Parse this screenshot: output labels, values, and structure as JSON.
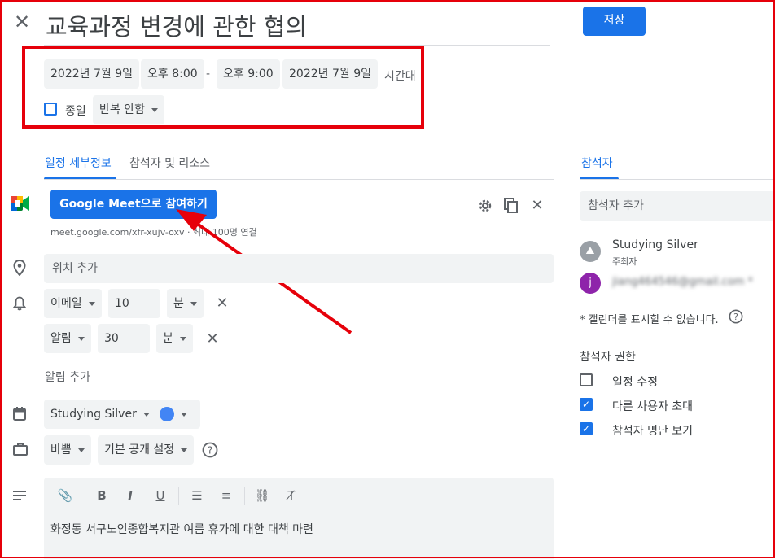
{
  "header": {
    "title": "교육과정 변경에 관한 협의",
    "save_label": "저장"
  },
  "datetime": {
    "start_date": "2022년 7월 9일",
    "start_time": "오후 8:00",
    "separator": "-",
    "end_time": "오후 9:00",
    "end_date": "2022년 7월 9일",
    "timezone_label": "시간대",
    "all_day_label": "종일",
    "repeat_label": "반복 안함"
  },
  "tabs": {
    "details": "일정 세부정보",
    "guests_resources": "참석자 및 리소스",
    "guests": "참석자"
  },
  "meet": {
    "join_label": "Google Meet으로 참여하기",
    "link_text": "meet.google.com/xfr-xujv-oxv · 최대 100명 연결"
  },
  "location": {
    "placeholder": "위치 추가"
  },
  "notifications": [
    {
      "type": "이메일",
      "value": "10",
      "unit": "분"
    },
    {
      "type": "알림",
      "value": "30",
      "unit": "분"
    }
  ],
  "add_notification_label": "알림 추가",
  "calendar": {
    "name": "Studying Silver",
    "color": "#4285f4"
  },
  "visibility": {
    "busy_label": "바쁨",
    "privacy_label": "기본 공개 설정"
  },
  "description": {
    "text": "화정동 서구노인종합복지관 여름 휴가에 대한 대책 마련"
  },
  "guests_panel": {
    "add_placeholder": "참석자 추가",
    "organizer": {
      "name": "Studying Silver",
      "role": "주최자"
    },
    "guest": {
      "initial": "j",
      "email": "jiang464546@gmail.com *"
    },
    "calendar_note": "* 캘린더를 표시할 수 없습니다.",
    "permissions_title": "참석자 권한",
    "permissions": [
      {
        "label": "일정 수정",
        "checked": false
      },
      {
        "label": "다른 사용자 초대",
        "checked": true
      },
      {
        "label": "참석자 명단 보기",
        "checked": true
      }
    ]
  },
  "colors": {
    "accent": "#1a73e8",
    "annotation": "#e6000a",
    "guest_avatar": "#8e24aa"
  }
}
